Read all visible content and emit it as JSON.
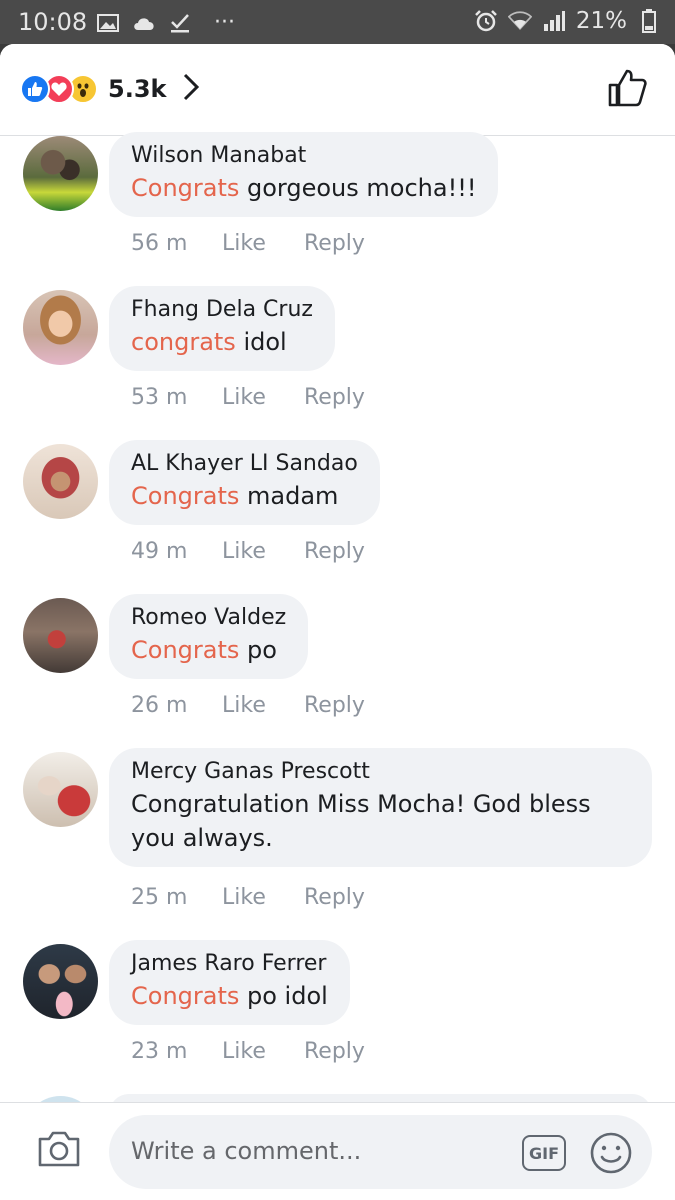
{
  "status_bar": {
    "time": "10:08",
    "dots": "···",
    "battery": "21%",
    "icons_left": [
      "image-icon",
      "cloud-icon",
      "download-check-icon"
    ],
    "icons_right": [
      "alarm-icon",
      "wifi-icon",
      "signal-icon",
      "battery-icon"
    ]
  },
  "header": {
    "reaction_count": "5.3k",
    "reaction_icons": [
      "like-reaction-icon",
      "love-reaction-icon",
      "wow-reaction-icon"
    ]
  },
  "comments": [
    {
      "name": "Wilson Manabat",
      "highlight": "Congrats",
      "text": " gorgeous mocha!!!",
      "time": "56 m",
      "like": "Like",
      "reply": "Reply"
    },
    {
      "name": "Fhang Dela Cruz",
      "highlight": "congrats",
      "text": " idol",
      "time": "53 m",
      "like": "Like",
      "reply": "Reply"
    },
    {
      "name": "AL Khayer LI Sandao",
      "highlight": "Congrats",
      "text": " madam",
      "time": "49 m",
      "like": "Like",
      "reply": "Reply"
    },
    {
      "name": "Romeo Valdez",
      "highlight": "Congrats",
      "text": " po",
      "time": "26 m",
      "like": "Like",
      "reply": "Reply"
    },
    {
      "name": "Mercy Ganas Prescott",
      "highlight": "",
      "text": "Congratulation Miss Mocha! God bless you always.",
      "time": "25 m",
      "like": "Like",
      "reply": "Reply"
    },
    {
      "name": "James Raro Ferrer",
      "highlight": "Congrats",
      "text": " po idol",
      "time": "23 m",
      "like": "Like",
      "reply": "Reply"
    }
  ],
  "composer": {
    "placeholder": "Write a comment...",
    "gif_label": "GIF"
  },
  "colors": {
    "highlight": "#e4654c",
    "bubble": "#f0f2f5",
    "meta": "#8d949e",
    "like_blue": "#1877f2"
  }
}
